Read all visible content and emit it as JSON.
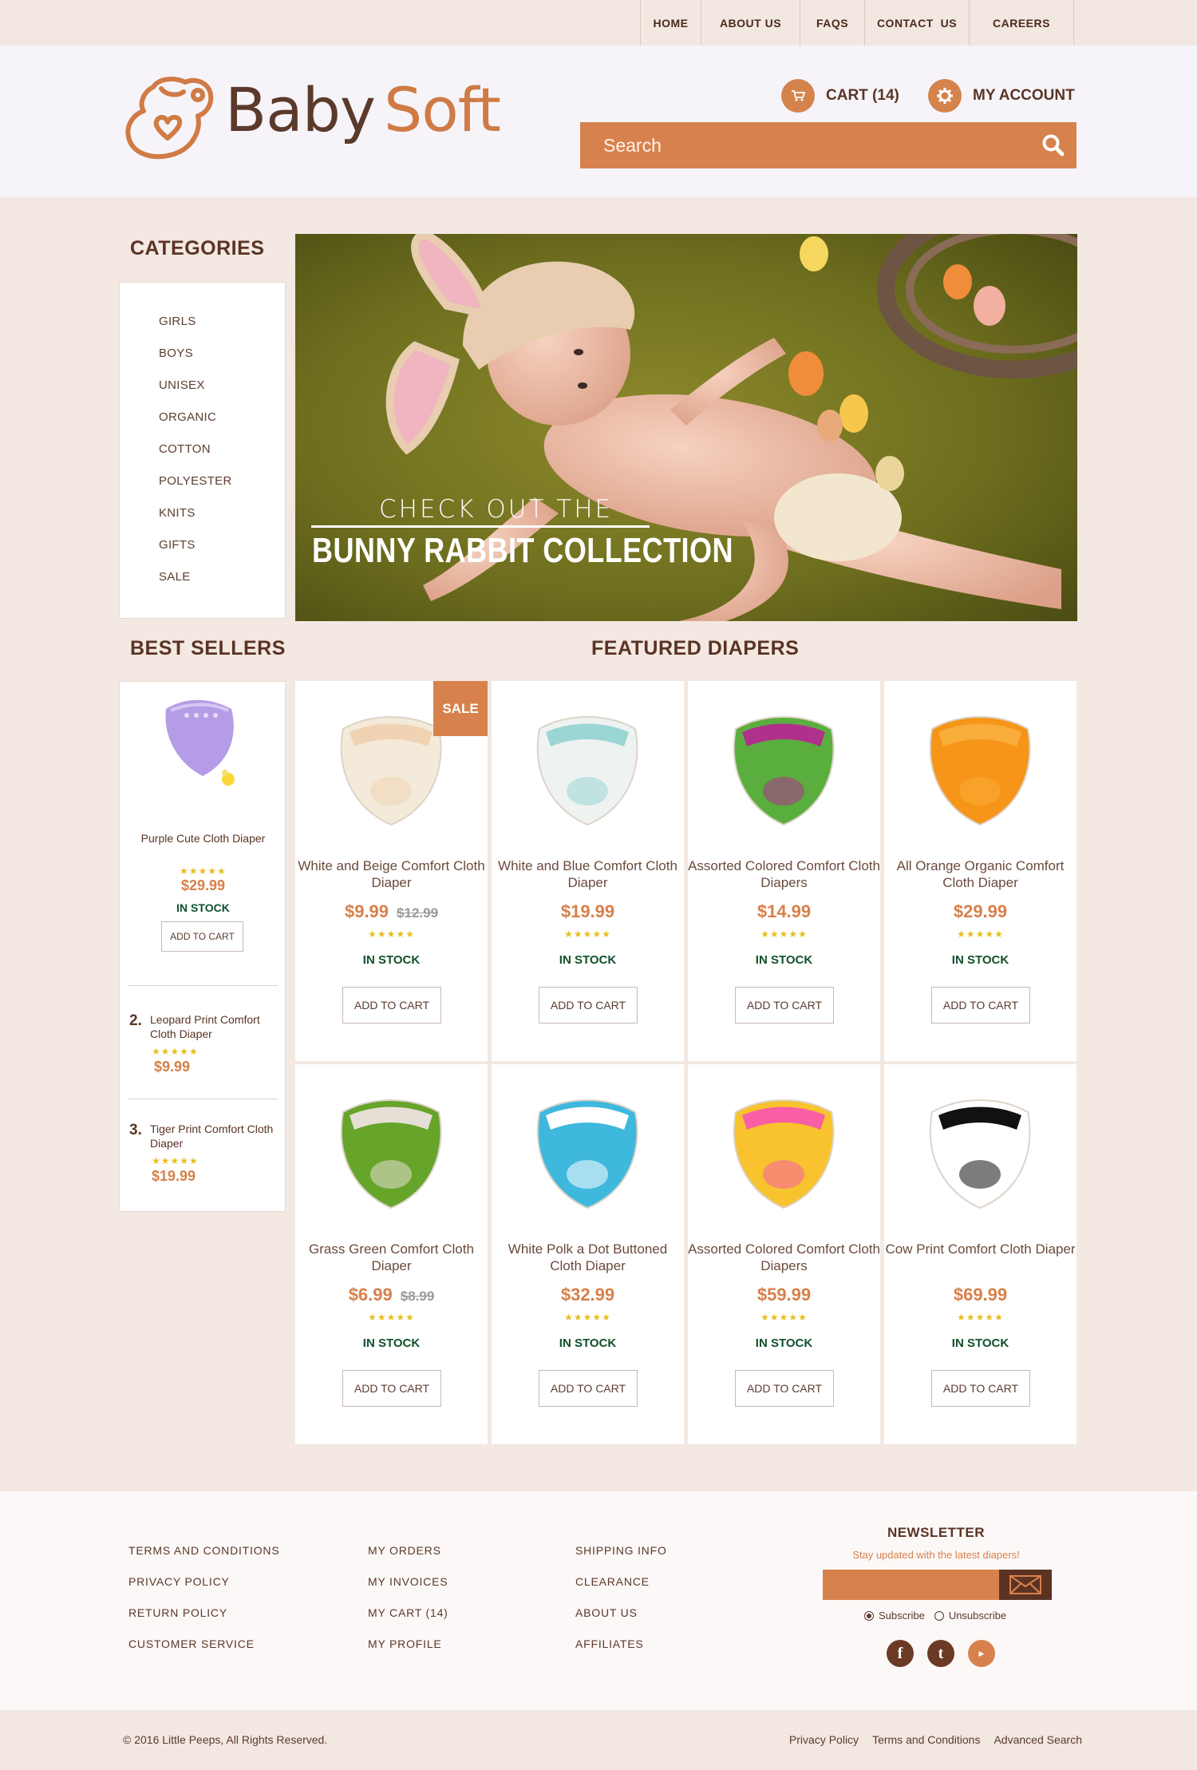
{
  "nav": [
    "HOME",
    "ABOUT US",
    "FAQS",
    "CONTACT  US",
    "CAREERS"
  ],
  "brand": {
    "part1": "Baby",
    "part2": "Soft"
  },
  "header": {
    "cart": "CART (14)",
    "account": "MY ACCOUNT",
    "search_placeholder": "Search"
  },
  "categories": {
    "title": "CATEGORIES",
    "items": [
      "GIRLS",
      "BOYS",
      "UNISEX",
      "ORGANIC",
      "COTTON",
      "POLYESTER",
      "KNITS",
      "GIFTS",
      "SALE"
    ]
  },
  "hero": {
    "line1": "CHECK OUT THE",
    "line2": "BUNNY RABBIT COLLECTION"
  },
  "best_sellers": {
    "title": "BEST SELLERS",
    "top": {
      "name": "Purple Cute Cloth Diaper",
      "stars": "★★★★★",
      "price": "$29.99",
      "stock": "IN STOCK",
      "button": "ADD TO CART"
    },
    "list": [
      {
        "rank": "2.",
        "name": "Leopard Print Comfort Cloth Diaper",
        "stars": "★★★★★",
        "price": "$9.99"
      },
      {
        "rank": "3.",
        "name": "Tiger Print Comfort Cloth Diaper",
        "stars": "★★★★★",
        "price": "$19.99"
      }
    ]
  },
  "featured": {
    "title": "FEATURED DIAPERS",
    "sale_badge": "SALE",
    "products": [
      {
        "name": "White and Beige Comfort Cloth Diaper",
        "price": "$9.99",
        "old_price": "$12.99",
        "stars": "★★★★★",
        "stock": "IN STOCK",
        "button": "ADD TO CART",
        "color": "#f4ead9",
        "accent": "#efd3b2"
      },
      {
        "name": "White and Blue Comfort Cloth Diaper",
        "price": "$19.99",
        "old_price": "",
        "stars": "★★★★★",
        "stock": "IN STOCK",
        "button": "ADD TO CART",
        "color": "#eef3f2",
        "accent": "#9ad6d4"
      },
      {
        "name": "Assorted Colored Comfort Cloth Diapers",
        "price": "$14.99",
        "old_price": "",
        "stars": "★★★★★",
        "stock": "IN STOCK",
        "button": "ADD TO CART",
        "color": "#5aae3e",
        "accent": "#b0318c"
      },
      {
        "name": "All Orange Organic Comfort Cloth Diaper",
        "price": "$29.99",
        "old_price": "",
        "stars": "★★★★★",
        "stock": "IN STOCK",
        "button": "ADD TO CART",
        "color": "#f69518",
        "accent": "#f9ad3a"
      },
      {
        "name": "Grass Green Comfort Cloth Diaper",
        "price": "$6.99",
        "old_price": "$8.99",
        "stars": "★★★★★",
        "stock": "IN STOCK",
        "button": "ADD TO CART",
        "color": "#66a42a",
        "accent": "#e6dfd5"
      },
      {
        "name": "White Polk a Dot Buttoned Cloth Diaper",
        "price": "$32.99",
        "old_price": "",
        "stars": "★★★★★",
        "stock": "IN STOCK",
        "button": "ADD TO CART",
        "color": "#3fb8dd",
        "accent": "#ffffff"
      },
      {
        "name": "Assorted Colored Comfort Cloth Diapers",
        "price": "$59.99",
        "old_price": "",
        "stars": "★★★★★",
        "stock": "IN STOCK",
        "button": "ADD TO CART",
        "color": "#f8c32e",
        "accent": "#f85fa5"
      },
      {
        "name": "Cow Print Comfort Cloth Diaper",
        "price": "$69.99",
        "old_price": "",
        "stars": "★★★★★",
        "stock": "IN STOCK",
        "button": "ADD TO CART",
        "color": "#ffffff",
        "accent": "#111111"
      }
    ]
  },
  "footer": {
    "col1": [
      "TERMS AND CONDITIONS",
      "PRIVACY POLICY",
      "RETURN POLICY",
      "CUSTOMER SERVICE"
    ],
    "col2": [
      "MY ORDERS",
      "MY INVOICES",
      "MY CART (14)",
      "MY PROFILE"
    ],
    "col3": [
      "SHIPPING INFO",
      "CLEARANCE",
      "ABOUT US",
      "AFFILIATES"
    ],
    "newsletter": {
      "title": "NEWSLETTER",
      "subtitle": "Stay updated with the latest diapers!",
      "subscribe": "Subscribe",
      "unsubscribe": "Unsubscribe"
    },
    "social": [
      "facebook-icon",
      "twitter-icon",
      "youtube-icon"
    ]
  },
  "bottom": {
    "copyright": "© 2016 Little Peeps, All Rights Reserved.",
    "links": [
      "Privacy Policy",
      "Terms and Conditions",
      "Advanced Search"
    ]
  },
  "colors": {
    "accent": "#d7824d",
    "brown": "#5a3324",
    "background": "#f3e8e2",
    "stock_green": "#10502c",
    "stars": "#e7be1f"
  }
}
